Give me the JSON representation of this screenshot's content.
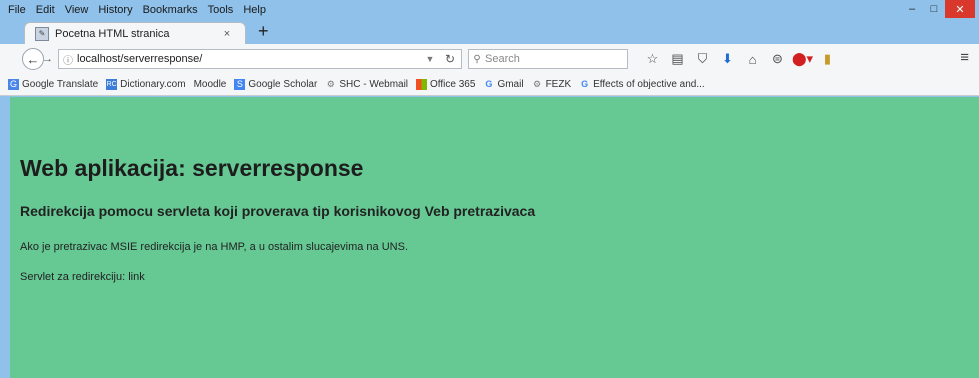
{
  "menubar": {
    "items": [
      "File",
      "Edit",
      "View",
      "History",
      "Bookmarks",
      "Tools",
      "Help"
    ]
  },
  "window_controls": {
    "minimize": "–",
    "maximize": "□",
    "close": "✕"
  },
  "tab": {
    "title": "Pocetna HTML stranica",
    "close": "×",
    "new_tab": "+"
  },
  "navbar": {
    "url": "localhost/serverresponse/",
    "search_placeholder": "Search"
  },
  "bookmarks": [
    {
      "label": "Google Translate",
      "icon": "google-translate-icon"
    },
    {
      "label": "Dictionary.com",
      "icon": "dictionary-icon"
    },
    {
      "label": "Moodle",
      "icon": "moodle-icon"
    },
    {
      "label": "Google Scholar",
      "icon": "google-scholar-icon"
    },
    {
      "label": "SHC - Webmail",
      "icon": "gear-icon"
    },
    {
      "label": "Office 365",
      "icon": "office-icon"
    },
    {
      "label": "Gmail",
      "icon": "google-icon"
    },
    {
      "label": "FEZK",
      "icon": "gear-icon"
    },
    {
      "label": "Effects of objective and...",
      "icon": "google-icon"
    }
  ],
  "page": {
    "heading": "Web aplikacija: serverresponse",
    "subheading": "Redirekcija pomocu servleta koji proverava tip korisnikovog Veb pretrazivaca",
    "paragraph1": "Ako je pretrazivac MSIE redirekcija je na HMP, a u ostalim slucajevima na UNS.",
    "paragraph2": "Servlet za redirekciju: link"
  },
  "colors": {
    "content_bg": "#66c994",
    "frame_bg": "#8fc1ea"
  }
}
